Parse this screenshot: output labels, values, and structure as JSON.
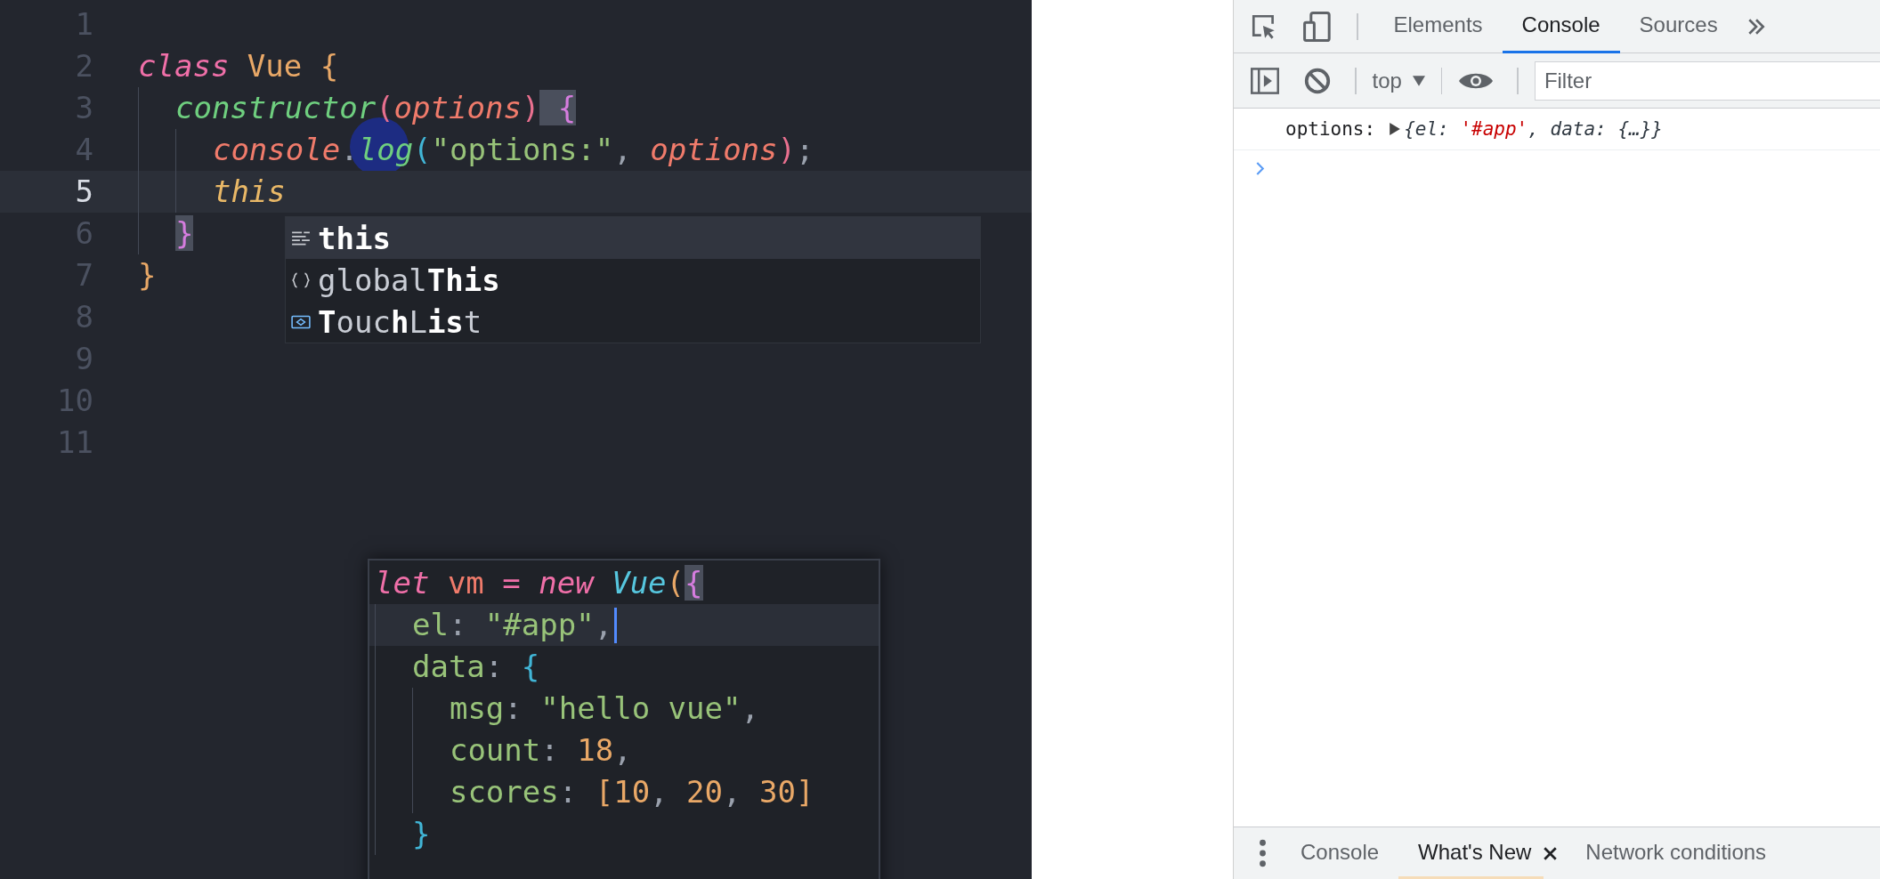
{
  "editor": {
    "lines": [
      {
        "number": "1",
        "current": false
      },
      {
        "number": "2",
        "current": false,
        "tokens": [
          {
            "text": "class ",
            "kind": "keyword"
          },
          {
            "text": "Vue ",
            "kind": "type"
          },
          {
            "text": "{",
            "kind": "brace-gold"
          }
        ]
      },
      {
        "number": "3",
        "current": false,
        "tokens": [
          {
            "text": "  constructor",
            "kind": "method"
          },
          {
            "text": "(",
            "kind": "paren-pink"
          },
          {
            "text": "options",
            "kind": "param"
          },
          {
            "text": ")",
            "kind": "paren-pink"
          },
          {
            "text": " {",
            "kind": "bracket-match"
          }
        ]
      },
      {
        "number": "4",
        "current": false,
        "tokens": [
          {
            "text": "    console",
            "kind": "param"
          },
          {
            "text": ".",
            "kind": "punct"
          },
          {
            "text": "log",
            "kind": "method"
          },
          {
            "text": "(",
            "kind": "paren-cyan"
          },
          {
            "text": "\"options:\"",
            "kind": "string"
          },
          {
            "text": ", ",
            "kind": "punct"
          },
          {
            "text": "options",
            "kind": "param"
          },
          {
            "text": ")",
            "kind": "paren-pink"
          },
          {
            "text": ";",
            "kind": "punct"
          }
        ]
      },
      {
        "number": "5",
        "current": true,
        "tokens": [
          {
            "text": "    this",
            "kind": "this"
          }
        ]
      },
      {
        "number": "6",
        "current": false,
        "tokens": [
          {
            "text": "  }",
            "kind": "bracket-match"
          }
        ]
      },
      {
        "number": "7",
        "current": false,
        "tokens": [
          {
            "text": "}",
            "kind": "brace-gold"
          }
        ]
      },
      {
        "number": "8",
        "current": false
      },
      {
        "number": "9",
        "current": false
      },
      {
        "number": "10",
        "current": false
      },
      {
        "number": "11",
        "current": false
      }
    ],
    "suggestions": [
      {
        "kind": "keyword",
        "label": "**this**",
        "selected": true
      },
      {
        "kind": "variable",
        "label": "global**This**",
        "selected": false
      },
      {
        "kind": "class",
        "label": "**T**ouc**h**L**is**t",
        "selected": false
      }
    ],
    "snippet": [
      {
        "current": false,
        "tokens": [
          {
            "text": "let ",
            "kind": "keyword"
          },
          {
            "text": "vm ",
            "kind": "variable"
          },
          {
            "text": "= ",
            "kind": "operator"
          },
          {
            "text": "new ",
            "kind": "keyword"
          },
          {
            "text": "Vue",
            "kind": "type-call"
          },
          {
            "text": "(",
            "kind": "brace-gold"
          },
          {
            "text": "{",
            "kind": "bracket-match"
          }
        ]
      },
      {
        "current": true,
        "tokens": [
          {
            "text": "  el",
            "kind": "property"
          },
          {
            "text": ": ",
            "kind": "punct"
          },
          {
            "text": "\"#app\"",
            "kind": "string"
          },
          {
            "text": ",",
            "kind": "punct"
          }
        ]
      },
      {
        "current": false,
        "tokens": [
          {
            "text": "  data",
            "kind": "property"
          },
          {
            "text": ": ",
            "kind": "punct"
          },
          {
            "text": "{",
            "kind": "paren-cyan"
          }
        ]
      },
      {
        "current": false,
        "tokens": [
          {
            "text": "    msg",
            "kind": "property"
          },
          {
            "text": ": ",
            "kind": "punct"
          },
          {
            "text": "\"hello vue\"",
            "kind": "string"
          },
          {
            "text": ",",
            "kind": "punct"
          }
        ]
      },
      {
        "current": false,
        "tokens": [
          {
            "text": "    count",
            "kind": "property"
          },
          {
            "text": ": ",
            "kind": "punct"
          },
          {
            "text": "18",
            "kind": "number"
          },
          {
            "text": ",",
            "kind": "punct"
          }
        ]
      },
      {
        "current": false,
        "tokens": [
          {
            "text": "    scores",
            "kind": "property"
          },
          {
            "text": ": ",
            "kind": "punct"
          },
          {
            "text": "[10",
            "kind": "number"
          },
          {
            "text": ", ",
            "kind": "punct"
          },
          {
            "text": "20",
            "kind": "number"
          },
          {
            "text": ", ",
            "kind": "punct"
          },
          {
            "text": "30]",
            "kind": "number"
          }
        ]
      },
      {
        "current": false,
        "tokens": [
          {
            "text": "  }",
            "kind": "paren-cyan"
          }
        ]
      }
    ]
  },
  "devtools": {
    "tabs": [
      {
        "label": "Elements",
        "selected": false
      },
      {
        "label": "Console",
        "selected": true
      },
      {
        "label": "Sources",
        "selected": false
      }
    ],
    "context": "top",
    "filter": {
      "placeholder": "Filter"
    },
    "messages": [
      {
        "label": "options:",
        "expanded": false,
        "parts": [
          {
            "text": "{el: ",
            "kind": "key"
          },
          {
            "text": "'#app'",
            "kind": "string"
          },
          {
            "text": ", data: {…}}",
            "kind": "key"
          }
        ]
      }
    ],
    "drawer_tabs": [
      {
        "label": "Console",
        "selected": false,
        "closable": false
      },
      {
        "label": "What's New",
        "selected": true,
        "closable": true
      },
      {
        "label": "Network conditions",
        "selected": false,
        "closable": false
      }
    ]
  }
}
